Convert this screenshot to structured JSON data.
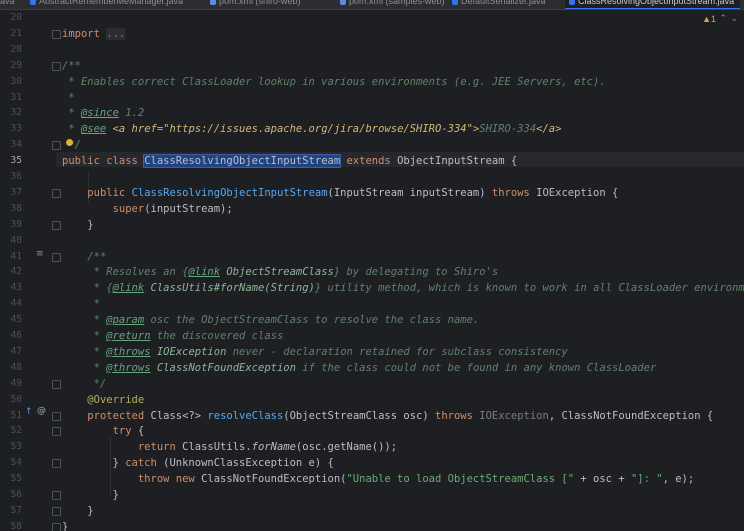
{
  "tabs": [
    {
      "label": "ava",
      "color": "#3574f0"
    },
    {
      "label": "AbstractRememberMeManager.java",
      "color": "#3574f0"
    },
    {
      "label": "pom.xml (shiro-web)",
      "color": "#5a8de0"
    },
    {
      "label": "pom.xml (samples-web)",
      "color": "#5a8de0"
    },
    {
      "label": "DefaultSerializer.java",
      "color": "#3574f0"
    },
    {
      "label": "ClassResolvingObjectInputStream.java",
      "color": "#3574f0",
      "active": true
    }
  ],
  "inspection": {
    "warning_count": "1"
  },
  "lines": [
    {
      "num": "20",
      "html": "",
      "cls": ""
    },
    {
      "num": "21",
      "html": "<span class=\"kw\">import</span> <span style=\"color:#7a7e85;background:#2b2d30\">...</span>"
    },
    {
      "num": "28",
      "html": ""
    },
    {
      "num": "29",
      "html": "<span class=\"doc\">/**</span>"
    },
    {
      "num": "30",
      "html": "<span class=\"doc\"> * Enables correct ClassLoader lookup in various environments (e.g. JEE Servers, etc).</span>"
    },
    {
      "num": "31",
      "html": "<span class=\"doc\"> *</span>"
    },
    {
      "num": "32",
      "html": "<span class=\"doc\"> * </span><span class=\"tag\">@since</span><span class=\"doc\"> 1.2</span>"
    },
    {
      "num": "33",
      "html": "<span class=\"doc\"> * </span><span class=\"tag\">@see</span><span class=\"doc\"> </span><span class=\"html-tag\">&lt;a href=\"https://issues.apache.org/jira/browse/SHIRO-334\"&gt;</span><span class=\"doc\">SHIRO-334</span><span class=\"html-tag\">&lt;/a&gt;</span>"
    },
    {
      "num": "34",
      "html": "<span class=\"doc\"> */</span>"
    },
    {
      "num": "35",
      "html": "<span class=\"kw\">public class</span> <span class=\"sel\">ClassResolvingObjectInputStream</span> <span class=\"kw\">extends</span> ObjectInputStream {",
      "current": true
    },
    {
      "num": "36",
      "html": ""
    },
    {
      "num": "37",
      "html": "    <span class=\"kw\">public</span> <span class=\"fn\">ClassResolvingObjectInputStream</span>(InputStream inputStream) <span class=\"kw\">throws</span> IOException {"
    },
    {
      "num": "38",
      "html": "        <span class=\"kw\">super</span>(inputStream);"
    },
    {
      "num": "39",
      "html": "    }"
    },
    {
      "num": "40",
      "html": ""
    },
    {
      "num": "41",
      "html": "    <span class=\"doc\">/**</span>"
    },
    {
      "num": "42",
      "html": "<span class=\"doc\">     * Resolves an {</span><span class=\"tag\">@link</span><span class=\"doc\"> </span><span class=\"doc\" style=\"color:#8fb59a\">ObjectStreamClass</span><span class=\"doc\">} by delegating to Shiro's</span>"
    },
    {
      "num": "43",
      "html": "<span class=\"doc\">     * {</span><span class=\"tag\">@link</span><span class=\"doc\"> </span><span class=\"doc\" style=\"color:#8fb59a\">ClassUtils#forName(String)</span><span class=\"doc\">} utility method, which is known to work in all ClassLoader environments.</span>"
    },
    {
      "num": "44",
      "html": "<span class=\"doc\">     *</span>"
    },
    {
      "num": "45",
      "html": "<span class=\"doc\">     * </span><span class=\"tag\">@param</span><span class=\"doc\"> osc the ObjectStreamClass to resolve the class name.</span>"
    },
    {
      "num": "46",
      "html": "<span class=\"doc\">     * </span><span class=\"tag\">@return</span><span class=\"doc\"> the discovered class</span>"
    },
    {
      "num": "47",
      "html": "<span class=\"doc\">     * </span><span class=\"tag\">@throws</span><span class=\"doc\"> </span><span class=\"doc\" style=\"color:#8fb59a\">IOException</span><span class=\"doc\"> never - declaration retained for subclass consistency</span>"
    },
    {
      "num": "48",
      "html": "<span class=\"doc\">     * </span><span class=\"tag\">@throws</span><span class=\"doc\"> </span><span class=\"doc\" style=\"color:#8fb59a\">ClassNotFoundException</span><span class=\"doc\"> if the class could not be found in any known ClassLoader</span>"
    },
    {
      "num": "49",
      "html": "<span class=\"doc\">     */</span>"
    },
    {
      "num": "50",
      "html": "    <span class=\"ann\">@Override</span>"
    },
    {
      "num": "51",
      "html": "    <span class=\"kw\">protected</span> Class&lt;?&gt; <span class=\"fn\">resolveClass</span>(ObjectStreamClass osc) <span class=\"kw\">throws</span> <span style=\"color:#7a7e85\">IOException</span>, ClassNotFoundException {"
    },
    {
      "num": "52",
      "html": "        <span class=\"kw\">try</span> {"
    },
    {
      "num": "53",
      "html": "            <span class=\"kw\">return</span> ClassUtils.<span class=\"static\">forName</span>(osc.getName());"
    },
    {
      "num": "54",
      "html": "        } <span class=\"kw\">catch</span> (UnknownClassException e) {"
    },
    {
      "num": "55",
      "html": "            <span class=\"kw\">throw new</span> ClassNotFoundException(<span class=\"str\">\"Unable to load ObjectStreamClass [\"</span> + osc + <span class=\"str\">\"]: \"</span>, e);"
    },
    {
      "num": "56",
      "html": "        }"
    },
    {
      "num": "57",
      "html": "    }"
    },
    {
      "num": "58",
      "html": "}"
    }
  ]
}
